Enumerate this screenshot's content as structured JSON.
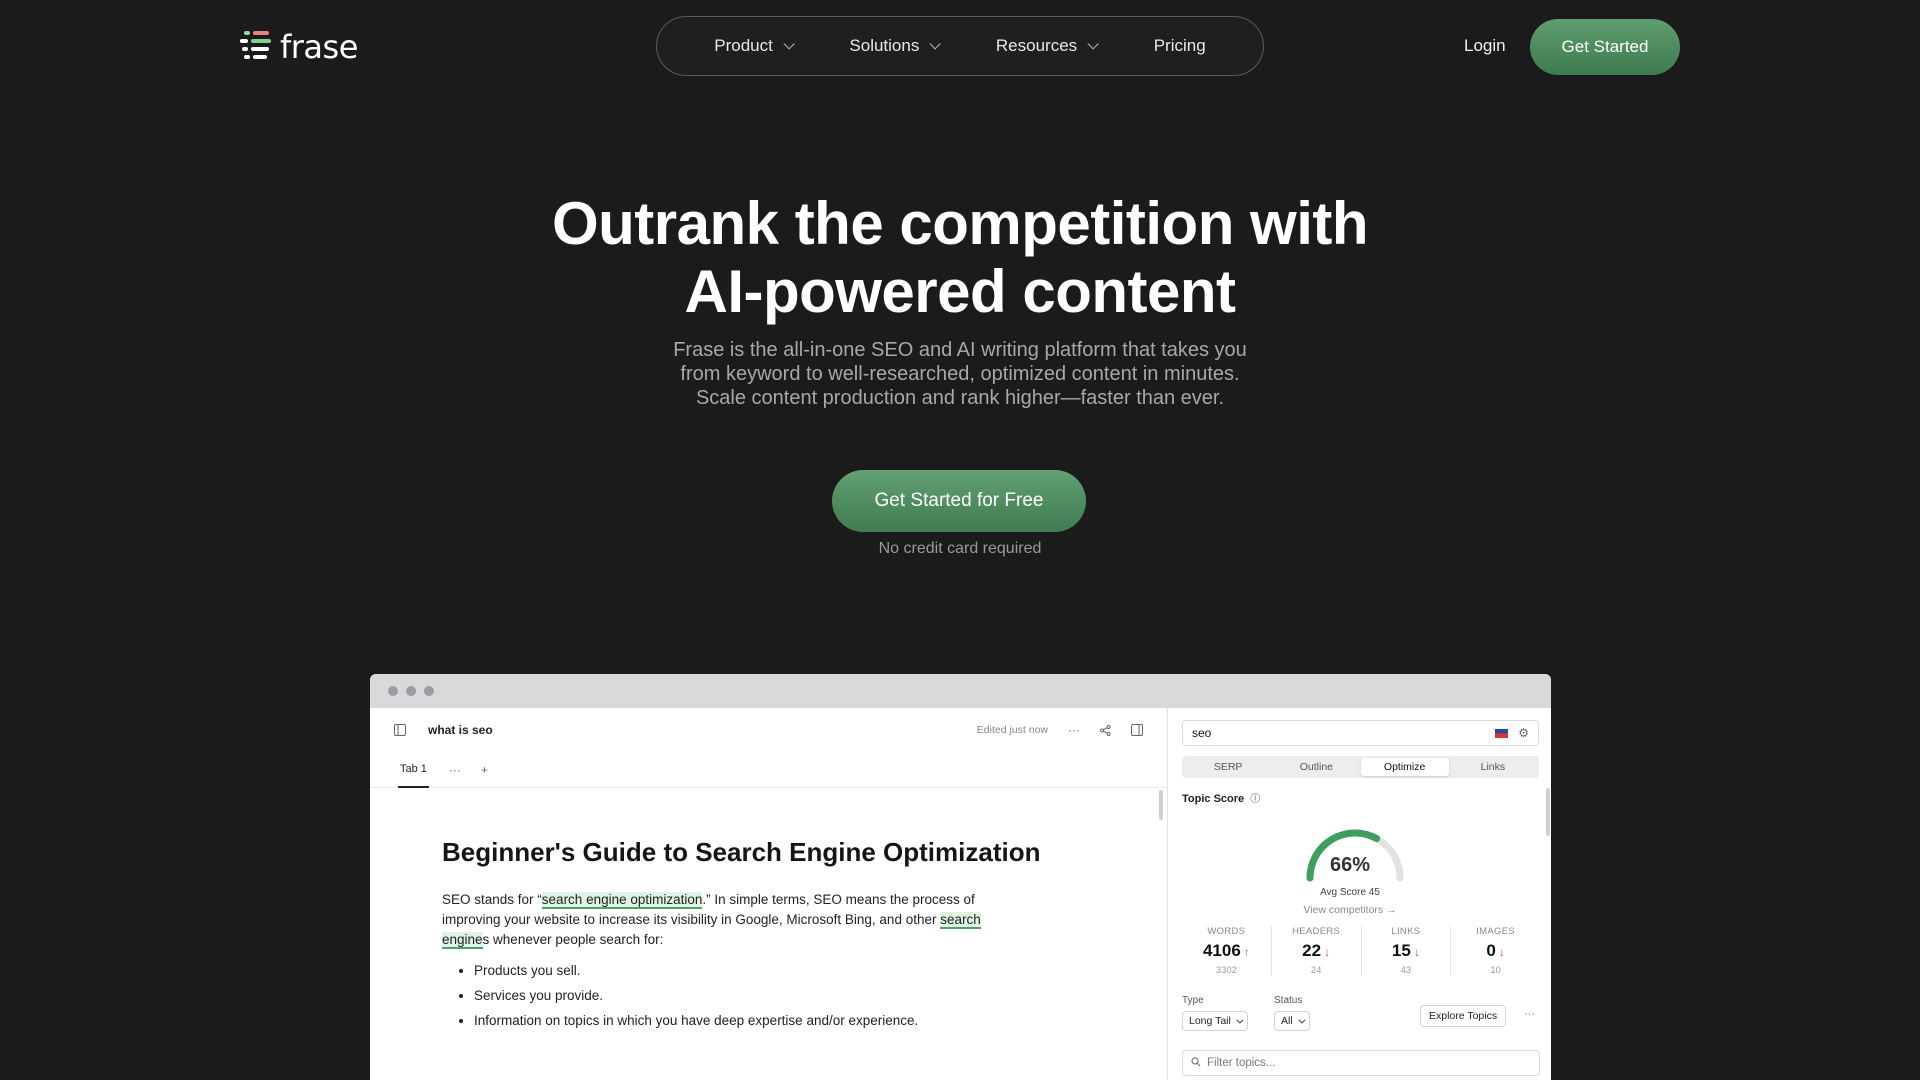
{
  "brand": {
    "name": "frase"
  },
  "nav": {
    "items": [
      {
        "label": "Product",
        "dropdown": true
      },
      {
        "label": "Solutions",
        "dropdown": true
      },
      {
        "label": "Resources",
        "dropdown": true
      },
      {
        "label": "Pricing",
        "dropdown": false
      }
    ],
    "login": "Login",
    "cta": "Get Started"
  },
  "hero": {
    "title_line1": "Outrank the competition with",
    "title_line2": "AI-powered content",
    "sub_line1": "Frase is the all-in-one SEO and AI writing platform that takes you",
    "sub_line2": "from keyword to well-researched, optimized content in minutes.",
    "sub_line3": "Scale content production and rank higher—faster than ever.",
    "cta": "Get Started for Free",
    "note": "No credit card required"
  },
  "colors": {
    "accent": "#4f8f60",
    "background": "#1b1b1b",
    "gauge": "#3e9e5e"
  },
  "editor": {
    "doc_title": "what is seo",
    "status": "Edited just now",
    "tab": "Tab 1",
    "heading": "Beginner's Guide to Search Engine Optimization",
    "para_pre": "SEO stands for “",
    "para_hl1": "search engine optimization",
    "para_mid": ".” In simple terms, SEO means the process of improving your website to increase its visibility in Google, Microsoft Bing, and other ",
    "para_hl2": "search engine",
    "para_post": "s whenever people search for:",
    "list": [
      "Products you sell.",
      "Services you provide.",
      "Information on topics in which you have deep expertise and/or experience."
    ]
  },
  "panel": {
    "query": "seo",
    "tabs": [
      "SERP",
      "Outline",
      "Optimize",
      "Links"
    ],
    "active_tab": "Optimize",
    "topic_score_label": "Topic Score",
    "score": "66%",
    "score_value": 0.66,
    "avg_score": "Avg Score 45",
    "view_competitors": "View competitors",
    "stats": [
      {
        "label": "WORDS",
        "value": "4106",
        "trend": "up",
        "sub": "3302"
      },
      {
        "label": "HEADERS",
        "value": "22",
        "trend": "down",
        "sub": "24"
      },
      {
        "label": "LINKS",
        "value": "15",
        "trend": "down",
        "sub": "43"
      },
      {
        "label": "IMAGES",
        "value": "0",
        "trend": "down",
        "sub": "10"
      }
    ],
    "type_label": "Type",
    "type_value": "Long Tail",
    "status_label": "Status",
    "status_value": "All",
    "explore": "Explore Topics",
    "filter_placeholder": "Filter topics..."
  }
}
